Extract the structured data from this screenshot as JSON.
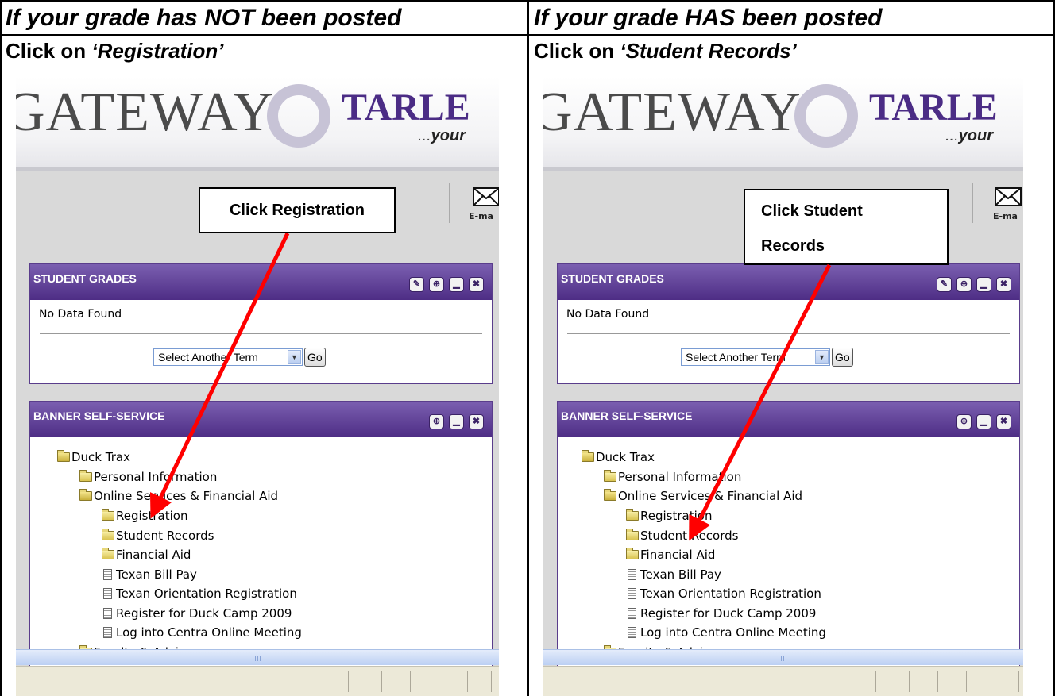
{
  "left": {
    "heading": "If your grade has NOT been posted",
    "instruction_prefix": "Click on ",
    "instruction_target": "‘Registration’",
    "callout": "Click Registration"
  },
  "right": {
    "heading": "If your grade HAS been posted",
    "instruction_prefix": "Click on ",
    "instruction_target": "‘Student Records’",
    "callout_line1": "Click Student",
    "callout_line2": "Records"
  },
  "screenshot": {
    "banner_gateway": "GATEWAY",
    "banner_tarle": "TARLE",
    "banner_dots": "...",
    "banner_your": "your",
    "email_label": "E-ma",
    "grades_portlet": {
      "title": "STUDENT GRADES",
      "no_data": "No Data Found",
      "term_select": "Select Another Term",
      "go_button": "Go"
    },
    "banner_portlet": {
      "title": "BANNER SELF-SERVICE",
      "items": [
        {
          "label": "Duck Trax",
          "icon": "folder-open-icon"
        },
        {
          "label": "Personal Information",
          "icon": "folder-icon"
        },
        {
          "label": "Online Services & Financial Aid",
          "icon": "folder-open-icon"
        },
        {
          "label": "Registration",
          "icon": "folder-icon"
        },
        {
          "label": "Student Records",
          "icon": "folder-icon"
        },
        {
          "label": "Financial Aid",
          "icon": "folder-icon"
        },
        {
          "label": "Texan Bill Pay",
          "icon": "page-icon"
        },
        {
          "label": "Texan Orientation Registration",
          "icon": "page-icon"
        },
        {
          "label": "Register for Duck Camp 2009",
          "icon": "page-icon"
        },
        {
          "label": "Log into Centra Online Meeting",
          "icon": "page-icon"
        },
        {
          "label": "Faculty & Advisors",
          "icon": "folder-icon"
        }
      ]
    }
  },
  "colors": {
    "portlet_header": "#4e2d85",
    "arrow": "#ff0000"
  }
}
